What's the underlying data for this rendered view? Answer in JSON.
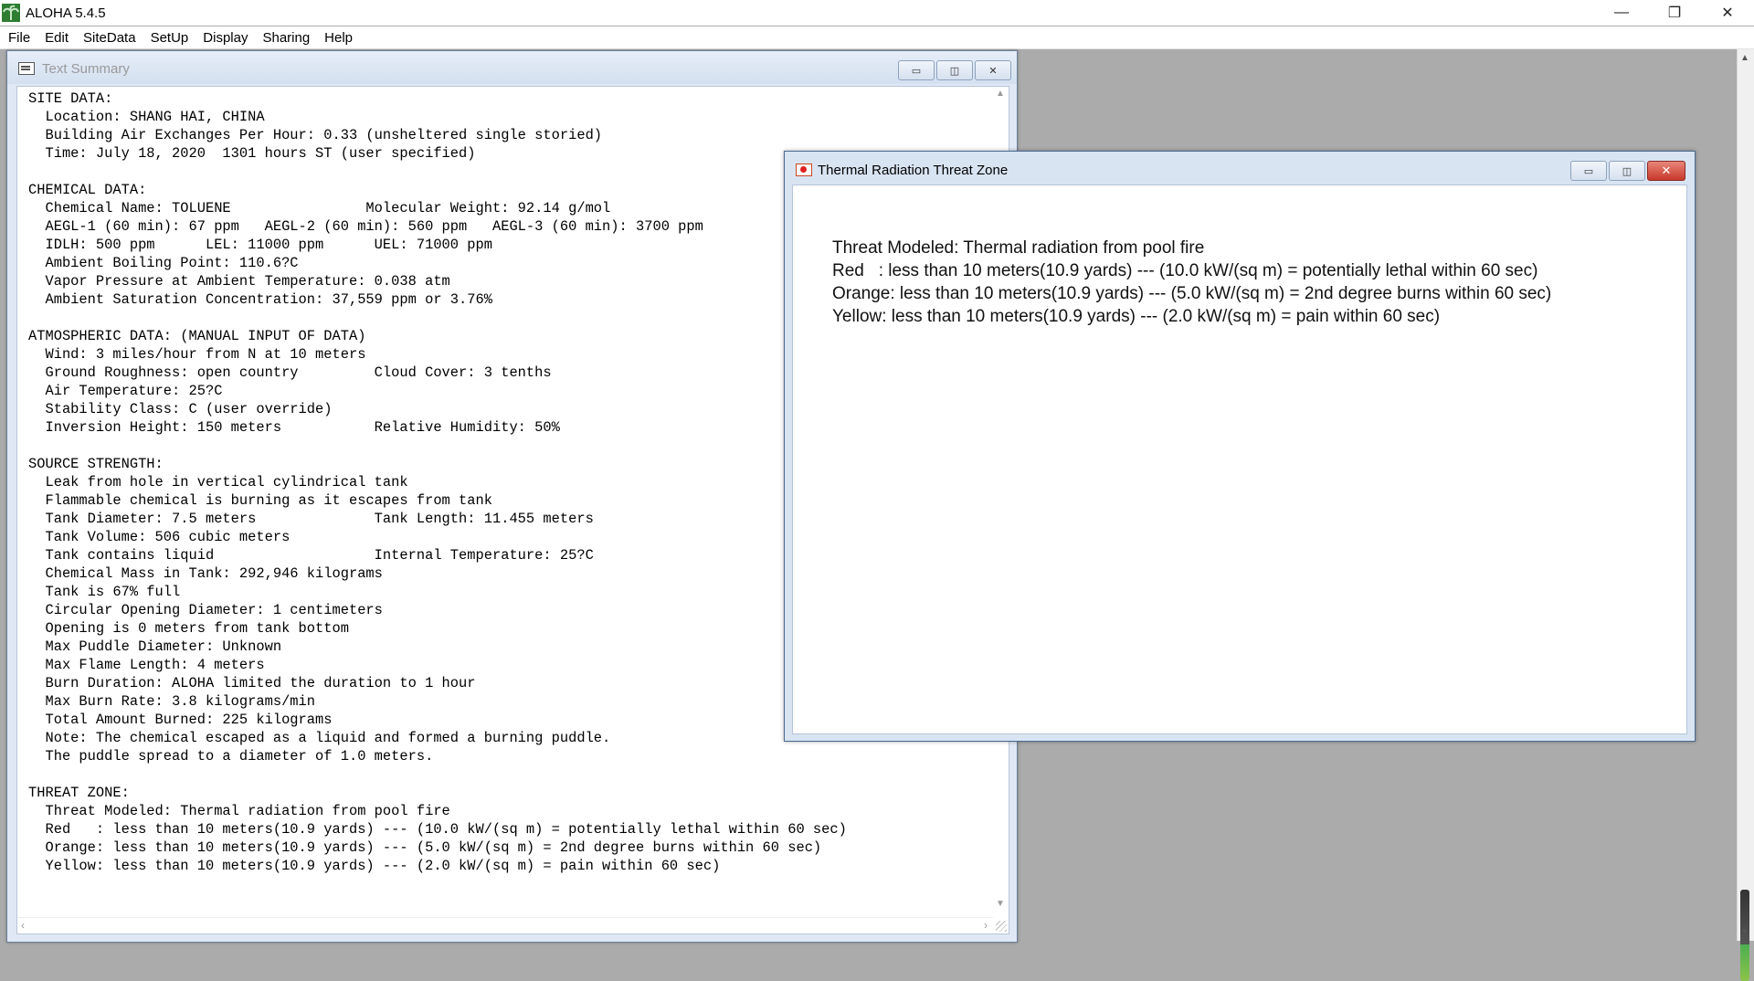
{
  "app": {
    "title": "ALOHA 5.4.5",
    "controls": {
      "minimize": "—",
      "restore": "❐",
      "close": "✕"
    }
  },
  "menu": [
    "File",
    "Edit",
    "SiteData",
    "SetUp",
    "Display",
    "Sharing",
    "Help"
  ],
  "text_summary": {
    "title": "Text Summary",
    "lines": [
      "SITE DATA:",
      "  Location: SHANG HAI, CHINA",
      "  Building Air Exchanges Per Hour: 0.33 (unsheltered single storied)",
      "  Time: July 18, 2020  1301 hours ST (user specified)",
      "",
      "CHEMICAL DATA:",
      "  Chemical Name: TOLUENE                Molecular Weight: 92.14 g/mol",
      "  AEGL-1 (60 min): 67 ppm   AEGL-2 (60 min): 560 ppm   AEGL-3 (60 min): 3700 ppm",
      "  IDLH: 500 ppm      LEL: 11000 ppm      UEL: 71000 ppm",
      "  Ambient Boiling Point: 110.6?C",
      "  Vapor Pressure at Ambient Temperature: 0.038 atm",
      "  Ambient Saturation Concentration: 37,559 ppm or 3.76%",
      "",
      "ATMOSPHERIC DATA: (MANUAL INPUT OF DATA)",
      "  Wind: 3 miles/hour from N at 10 meters",
      "  Ground Roughness: open country         Cloud Cover: 3 tenths",
      "  Air Temperature: 25?C",
      "  Stability Class: C (user override)",
      "  Inversion Height: 150 meters           Relative Humidity: 50%",
      "",
      "SOURCE STRENGTH:",
      "  Leak from hole in vertical cylindrical tank",
      "  Flammable chemical is burning as it escapes from tank",
      "  Tank Diameter: 7.5 meters              Tank Length: 11.455 meters",
      "  Tank Volume: 506 cubic meters",
      "  Tank contains liquid                   Internal Temperature: 25?C",
      "  Chemical Mass in Tank: 292,946 kilograms",
      "  Tank is 67% full",
      "  Circular Opening Diameter: 1 centimeters",
      "  Opening is 0 meters from tank bottom",
      "  Max Puddle Diameter: Unknown",
      "  Max Flame Length: 4 meters",
      "  Burn Duration: ALOHA limited the duration to 1 hour",
      "  Max Burn Rate: 3.8 kilograms/min",
      "  Total Amount Burned: 225 kilograms",
      "  Note: The chemical escaped as a liquid and formed a burning puddle.",
      "  The puddle spread to a diameter of 1.0 meters.",
      "",
      "THREAT ZONE:",
      "  Threat Modeled: Thermal radiation from pool fire",
      "  Red   : less than 10 meters(10.9 yards) --- (10.0 kW/(sq m) = potentially lethal within 60 sec)",
      "  Orange: less than 10 meters(10.9 yards) --- (5.0 kW/(sq m) = 2nd degree burns within 60 sec)",
      "  Yellow: less than 10 meters(10.9 yards) --- (2.0 kW/(sq m) = pain within 60 sec)"
    ]
  },
  "threat_zone": {
    "title": "Thermal Radiation Threat Zone",
    "lines": [
      "Threat Modeled: Thermal radiation from pool fire",
      "Red   : less than 10 meters(10.9 yards) --- (10.0 kW/(sq m) = potentially lethal within 60 sec)",
      "Orange: less than 10 meters(10.9 yards) --- (5.0 kW/(sq m) = 2nd degree burns within 60 sec)",
      "Yellow: less than 10 meters(10.9 yards) --- (2.0 kW/(sq m) = pain within 60 sec)"
    ]
  },
  "colors": {
    "workspace_bg": "#ababab",
    "window_frame": "#dfe8f4",
    "close_button": "#c8392b"
  }
}
